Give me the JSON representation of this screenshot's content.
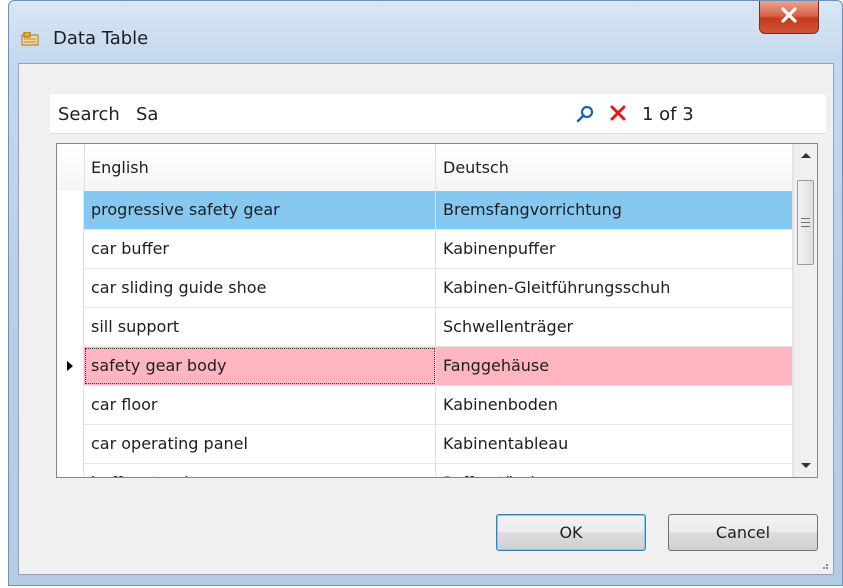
{
  "window": {
    "title": "Data Table"
  },
  "search": {
    "label": "Search",
    "value": "Sa",
    "match_count": "1 of 3"
  },
  "table": {
    "columns": [
      "English",
      "Deutsch"
    ],
    "rows": [
      {
        "en": "progressive safety gear",
        "de": "Bremsfangvorrichtung",
        "state": "selected"
      },
      {
        "en": "car buffer",
        "de": "Kabinenpuffer",
        "state": "normal"
      },
      {
        "en": "car sliding guide shoe",
        "de": "Kabinen-Gleitführungsschuh",
        "state": "normal"
      },
      {
        "en": "sill support",
        "de": "Schwellenträger",
        "state": "normal"
      },
      {
        "en": "safety gear body",
        "de": "Fanggehäuse",
        "state": "current-match"
      },
      {
        "en": "car floor",
        "de": "Kabinenboden",
        "state": "normal"
      },
      {
        "en": "car operating panel",
        "de": "Kabinentableau",
        "state": "normal"
      },
      {
        "en": "buffer stand",
        "de": "Pufferständer",
        "state": "partially-visible"
      }
    ]
  },
  "buttons": {
    "ok": "OK",
    "cancel": "Cancel"
  },
  "icons": {
    "app": "app-icon",
    "close": "close-icon",
    "search": "search-icon",
    "clear": "clear-icon",
    "row_pointer": "row-pointer-icon"
  },
  "colors": {
    "selected_row": "#86c8f0",
    "match_row": "#ffb6c1",
    "close_button": "#c3391b",
    "search_icon": "#1f5fb3",
    "clear_icon": "#e01919"
  }
}
